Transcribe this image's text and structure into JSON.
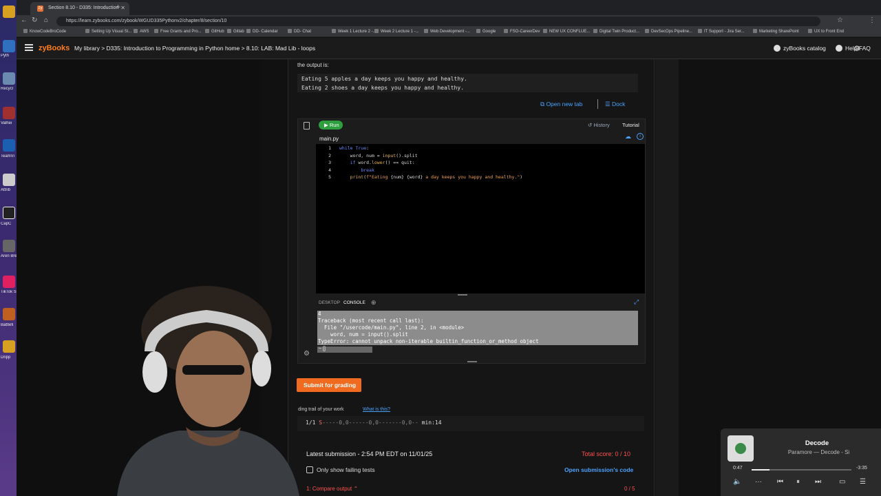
{
  "browser": {
    "tab_title": "Section 8.10 - D335: Introduction",
    "tab_favicon": "zy",
    "url": "https://learn.zybooks.com/zybook/WGUD335Pythonv2/chapter/8/section/10",
    "bookmarks": [
      "KnowCodeBroCode",
      "Setting Up Visual St...",
      "AWS",
      "Free Grants and Pro...",
      "GitHub",
      "Gitlab",
      "DD- Calendar",
      "DD- Chat",
      "Week 1 Lecture 2 -...",
      "Week 2 Lecture 1 -...",
      "Web Development -...",
      "Google",
      "FSO-CareerDev",
      "NEW UX CONFLUE...",
      "Digital Twin Product...",
      "DevSecOps Pipeline...",
      "IT Support - Jira Ser...",
      "Marketing SharePoint",
      "UX to Front End"
    ]
  },
  "desktop": {
    "labels": [
      "Pyth",
      "Recycl",
      "Valhei",
      "TeamVi",
      "Attrib",
      "CapC",
      "Aren Break",
      "TikTok Stud",
      "Battlefi",
      "Dripp"
    ]
  },
  "header": {
    "logo": "zyBooks",
    "breadcrumb": "My library  > D335: Introduction to Programming in Python home  > 8.10: LAB: Mad Lib - loops",
    "catalog": "zyBooks catalog",
    "help": "Help/FAQ"
  },
  "content": {
    "output_intro": "the output is:",
    "expected_output": [
      "Eating 5 apples a day keeps you happy and healthy.",
      "Eating 2 shoes a day keeps you happy and healthy."
    ],
    "open_new_tab": "Open new tab",
    "dock": "Dock"
  },
  "ide": {
    "run_label": "Run",
    "history_label": "History",
    "tutorial_label": "Tutorial",
    "filename": "main.py",
    "console_tabs": [
      "DESKTOP",
      "CONSOLE"
    ],
    "console_lines": [
      "4",
      "Traceback (most recent call last):",
      "  File \"/usercode/main.py\", line 2, in <module>",
      "    word, num = input().split",
      "TypeError: cannot unpack non-iterable builtin_function_or_method object"
    ],
    "console_prompt": "~ []"
  },
  "code_lines": [
    {
      "num": "1",
      "indent": "",
      "parts": [
        [
          "kw",
          "while "
        ],
        [
          "kw",
          "True"
        ],
        [
          "tx",
          ":"
        ]
      ]
    },
    {
      "num": "2",
      "indent": "    ",
      "parts": [
        [
          "tx",
          "word, num = "
        ],
        [
          "fn",
          "input"
        ],
        [
          "tx",
          "().split"
        ]
      ]
    },
    {
      "num": "3",
      "indent": "    ",
      "parts": [
        [
          "kw",
          "if "
        ],
        [
          "tx",
          "word."
        ],
        [
          "fn",
          "lower"
        ],
        [
          "tx",
          "() == quit:"
        ]
      ]
    },
    {
      "num": "4",
      "indent": "        ",
      "parts": [
        [
          "kw",
          "break"
        ]
      ]
    },
    {
      "num": "5",
      "indent": "    ",
      "parts": [
        [
          "fn",
          "print"
        ],
        [
          "tx",
          "("
        ],
        [
          "str",
          "f\"Eating "
        ],
        [
          "tx",
          "{num} {word}"
        ],
        [
          "str",
          " a day keeps you happy and healthy.\""
        ],
        [
          "tx",
          ")"
        ]
      ]
    }
  ],
  "submission": {
    "submit_label": "Submit for grading",
    "trail_label": "ding trail of your work",
    "what_is_this": "What is this?",
    "trail_prefix": "1/1",
    "trail_s": "S",
    "trail_rest": "-----0,0------0,0-------0,0--",
    "trail_min": "min:14",
    "latest": "Latest submission - 2:54 PM EDT on 11/01/25",
    "total_score": "Total score: 0 / 10",
    "only_failing": "Only show failing tests",
    "open_code": "Open submission's code",
    "compare": "1: Compare output",
    "compare_score": "0 / 5"
  },
  "media": {
    "song": "Decode",
    "artist": "Paramore — Decode - Si",
    "time_current": "0:47",
    "time_remaining": "-3:35",
    "progress": 0.18
  },
  "colors": {
    "accent_orange": "#f06a1f",
    "link_blue": "#4aa3ff",
    "error_red": "#ff5050",
    "run_green": "#2e9f3e"
  }
}
